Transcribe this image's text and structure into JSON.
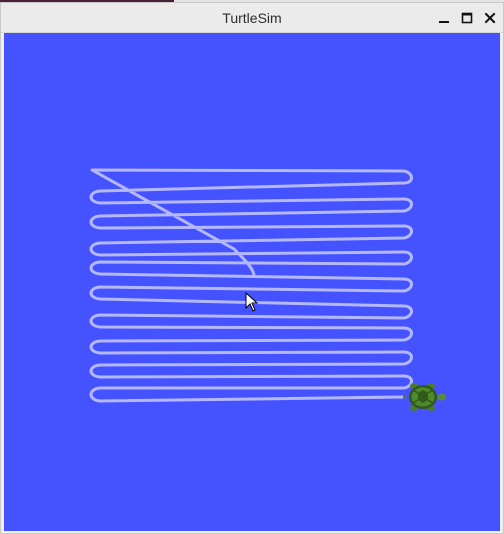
{
  "window": {
    "title": "TurtleSim",
    "controls": {
      "minimize": "minimize-icon",
      "maximize": "maximize-icon",
      "close": "close-icon"
    }
  },
  "canvas": {
    "background_color": "#4552ff",
    "pen_color": "#b3b8ff",
    "turtle_icon": "turtle-icon",
    "cursor_icon": "mouse-pointer-icon"
  }
}
